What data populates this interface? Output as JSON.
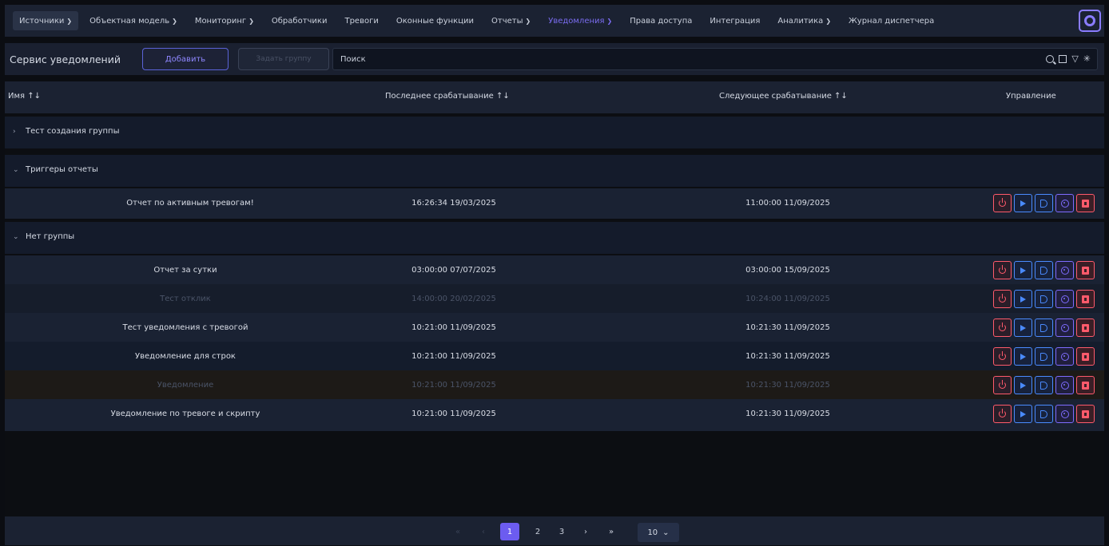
{
  "nav": {
    "items": [
      {
        "label": "Источники",
        "dropdown": true
      },
      {
        "label": "Объектная модель",
        "dropdown": true
      },
      {
        "label": "Мониторинг",
        "dropdown": true
      },
      {
        "label": "Обработчики",
        "dropdown": false
      },
      {
        "label": "Тревоги",
        "dropdown": false
      },
      {
        "label": "Оконные функции",
        "dropdown": false
      },
      {
        "label": "Отчеты",
        "dropdown": true
      },
      {
        "label": "Уведомления",
        "dropdown": true,
        "active": true
      },
      {
        "label": "Права доступа",
        "dropdown": false
      },
      {
        "label": "Интеграция",
        "dropdown": false
      },
      {
        "label": "Аналитика",
        "dropdown": true
      },
      {
        "label": "Журнал диспетчера",
        "dropdown": false
      }
    ],
    "settings_icon": "gear-icon"
  },
  "toolbar": {
    "title": "Сервис уведомлений",
    "add_label": "Добавить",
    "group_label": "Задать группу",
    "search_placeholder": "Поиск"
  },
  "table": {
    "columns": {
      "name": "Имя ↑↓",
      "last": "Последнее срабатывание ↑↓",
      "next": "Следующее срабатывание ↑↓",
      "control": "Управление"
    },
    "groups": [
      {
        "label": "Тест создания группы",
        "expanded": false,
        "rows": []
      },
      {
        "label": "Триггеры отчеты",
        "expanded": true,
        "rows": [
          {
            "name": "Отчет по активным тревогам!",
            "last": "16:26:34 19/03/2025",
            "next": "11:00:00 11/09/2025"
          }
        ]
      },
      {
        "label": "Нет группы",
        "expanded": true,
        "rows": [
          {
            "name": "Отчет за сутки",
            "last": "03:00:00 07/07/2025",
            "next": "03:00:00 15/09/2025"
          },
          {
            "name": "Тест отклик",
            "last": "14:00:00 20/02/2025",
            "next": "10:24:00 11/09/2025",
            "disabled": true
          },
          {
            "name": "Тест уведомления с тревогой",
            "last": "10:21:00 11/09/2025",
            "next": "10:21:30 11/09/2025"
          },
          {
            "name": "Уведомление для строк",
            "last": "10:21:00 11/09/2025",
            "next": "10:21:30 11/09/2025"
          },
          {
            "name": "Уведомление",
            "last": "10:21:00 11/09/2025",
            "next": "10:21:30 11/09/2025",
            "disabled": true
          },
          {
            "name": "Уведомление по тревоге и скрипту",
            "last": "10:21:00 11/09/2025",
            "next": "10:21:30 11/09/2025"
          }
        ]
      }
    ]
  },
  "pager": {
    "first": "«",
    "prev": "‹",
    "pages": [
      "1",
      "2",
      "3"
    ],
    "current": "1",
    "next": "›",
    "last": "»",
    "page_size": "10"
  },
  "colors": {
    "accent": "#7a6cf0",
    "danger": "#ff5a6b",
    "info": "#4a8bff"
  }
}
